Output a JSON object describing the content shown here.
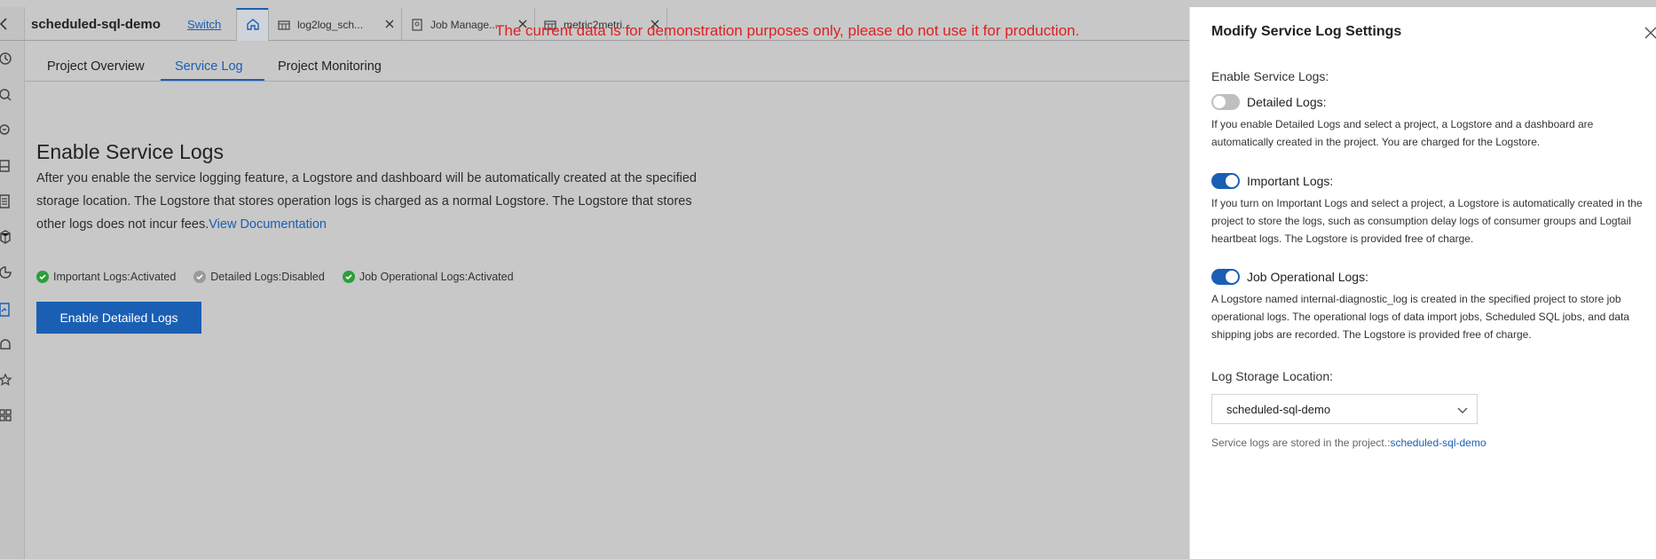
{
  "topbar": {
    "project_name": "scheduled-sql-demo",
    "switch_label": "Switch",
    "tabs": [
      {
        "label": "log2log_sch...",
        "icon": "table-icon"
      },
      {
        "label": "Job Manage...",
        "icon": "job-icon"
      },
      {
        "label": "metric2metri...",
        "icon": "table-icon"
      }
    ]
  },
  "banner": "The current data is for demonstration purposes only, please do not use it for production.",
  "page_tabs": [
    "Project Overview",
    "Service Log",
    "Project Monitoring"
  ],
  "active_page_tab": "Service Log",
  "main": {
    "title": "Enable Service Logs",
    "description": "After you enable the service logging feature, a Logstore and dashboard will be automatically created at the specified storage location. The Logstore that stores operation logs is charged as a normal Logstore. The Logstore that stores other logs does not incur fees.",
    "doc_link": "View Documentation",
    "statuses": [
      {
        "text": "Important Logs:Activated",
        "state": "active"
      },
      {
        "text": "Detailed Logs:Disabled",
        "state": "disabled"
      },
      {
        "text": "Job Operational Logs:Activated",
        "state": "active"
      }
    ],
    "enable_button": "Enable Detailed Logs"
  },
  "drawer": {
    "title": "Modify Service Log Settings",
    "enable_label": "Enable Service Logs:",
    "toggles": [
      {
        "label": "Detailed Logs:",
        "on": false,
        "desc": "If you enable Detailed Logs and select a project, a Logstore and a dashboard are automatically created in the project. You are charged for the Logstore."
      },
      {
        "label": "Important Logs:",
        "on": true,
        "desc": "If you turn on Important Logs and select a project, a Logstore is automatically created in the project to store the logs, such as consumption delay logs of consumer groups and Logtail heartbeat logs. The Logstore is provided free of charge."
      },
      {
        "label": "Job Operational Logs:",
        "on": true,
        "desc": "A Logstore named internal-diagnostic_log is created in the specified project to store job operational logs. The operational logs of data import jobs, Scheduled SQL jobs, and data shipping jobs are recorded. The Logstore is provided free of charge."
      }
    ],
    "storage_label": "Log Storage Location:",
    "storage_value": "scheduled-sql-demo",
    "storage_note": "Service logs are stored in the project.:",
    "storage_note_project": "scheduled-sql-demo"
  },
  "colors": {
    "accent": "#1a5fb4",
    "success": "#2e9e3a",
    "disabled": "#9a9a9a",
    "banner": "#e02020"
  }
}
